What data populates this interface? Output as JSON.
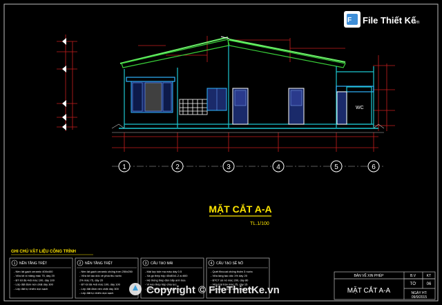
{
  "drawing": {
    "title": "MẶT CẮT A-A",
    "scale": "TL.1/100",
    "grid_axes": [
      "1",
      "2",
      "3",
      "4",
      "5",
      "6"
    ],
    "room_labels": {
      "wc": "WC"
    },
    "notes_heading": "GHI CHÚ VẬT LIỆU CÔNG TRÌNH",
    "legend": [
      {
        "num": "1",
        "title": "NỀN TẦNG TRỆT",
        "lines": [
          "- Nền lát gạch ceramic 400x400",
          "- Vữa lót xi măng mác 75, dày 20",
          "- BT lót đá 4x6 mác 100, dày 100",
          "- Lớp đất đầm nén chặt dày 300",
          "- Lớp đất tự nhiên dọn sạch"
        ]
      },
      {
        "num": "2",
        "title": "NỀN TẦNG TRỆT",
        "lines": [
          "- Nền lát gạch ceramic chống trơn 250x250",
          "- Vữa lót tạo dốc về phía thu nước",
          "  2% mác 75, dày 20",
          "- BT lót đá 4x6 mác 100, dày 100",
          "- Lớp đất đầm nén chặt dày 300",
          "- Lớp đất tự nhiên dọn sạch"
        ]
      },
      {
        "num": "3",
        "title": "CẤU TẠO MÁI",
        "lines": [
          "- Mái lợp tole mạ màu dày 0.5",
          "- Xà gồ thép hộp 40x80x1.2 a=600",
          "- Hệ thống thép đòn bẩy anh bùa",
          "- Vì kèo thép hộp chịu lực",
          "- Trần thạch cao khung chìm"
        ]
      },
      {
        "num": "4",
        "title": "CẤU TẠO SÊ NÔ",
        "lines": [
          "- Quét flincoat chống thấm 3 nước",
          "- Vữa láng tạo dốc 1% dày 20",
          "- BTCT sê nô mác 200, dày 80",
          "- Vữa trát trần mác 75, dày 15",
          "- Bả matit, sơn 3 nước hoàn thiện"
        ]
      }
    ],
    "title_block": {
      "sheet_type": "BẢN VẼ XIN PHÉP",
      "sheet_title": "MẶT CẮT A-A",
      "code_label": "B.V",
      "code_value": "KT",
      "sheet_no_label": "TỜ",
      "sheet_no_value": "06",
      "date_label": "NGÀY HT:",
      "date_value": "09/9/2015"
    }
  },
  "watermark": {
    "logo_text": "File Thiết Kế",
    "logo_suffix": ".vn",
    "copyright": "Copyright © FileThietKe.vn"
  },
  "colors": {
    "background": "#000000",
    "frame": "#ffffff",
    "wall": "#00c8c8",
    "roof": "#39d13a",
    "dimension": "#d02020",
    "title": "#ffe600",
    "grid_axis": "#ffffff",
    "window": "#2a3a8c"
  }
}
